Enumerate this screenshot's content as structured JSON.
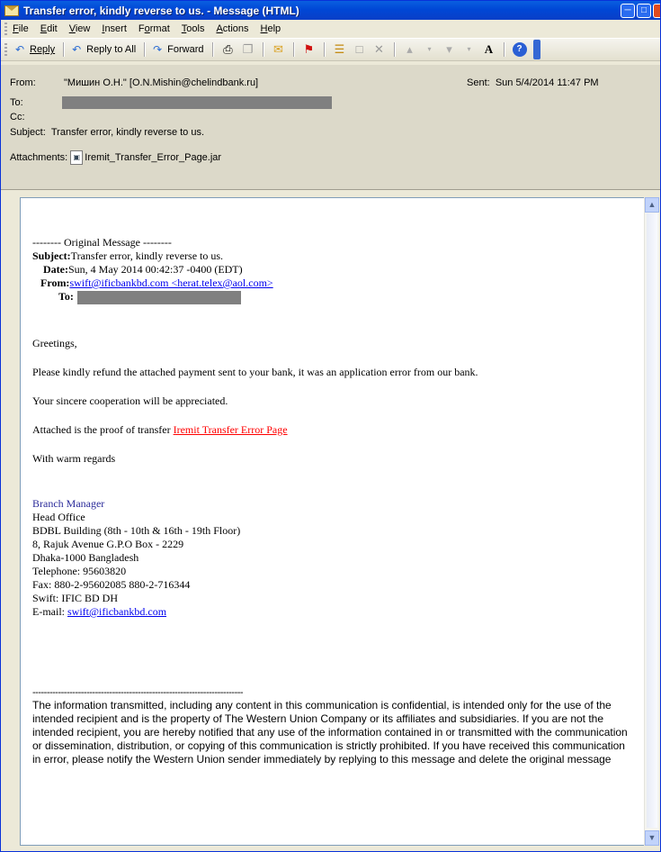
{
  "window": {
    "title": "Transfer error, kindly reverse to us. - Message (HTML)"
  },
  "menu": [
    "File",
    "Edit",
    "View",
    "Insert",
    "Format",
    "Tools",
    "Actions",
    "Help"
  ],
  "menu_underline": [
    "F",
    "E",
    "V",
    "I",
    "o",
    "T",
    "A",
    "H"
  ],
  "toolbar": {
    "reply": "Reply",
    "reply_all": "Reply to All",
    "forward": "Forward"
  },
  "header": {
    "from_label": "From:",
    "from_value": "\"Мишин О.Н.\" [O.N.Mishin@chelindbank.ru]",
    "sent_label": "Sent:",
    "sent_value": "Sun 5/4/2014 11:47 PM",
    "to_label": "To:",
    "cc_label": "Cc:",
    "subject_label": "Subject:",
    "subject_value": "Transfer error, kindly reverse to us.",
    "attachments_label": "Attachments:",
    "attachment_name": "Iremit_Transfer_Error_Page.jar"
  },
  "body": {
    "original_message": "-------- Original Message --------",
    "subject_label": "Subject:",
    "subject_value": "Transfer error, kindly reverse to us.",
    "date_label": "Date:",
    "date_value": "Sun, 4 May 2014 00:42:37 -0400 (EDT)",
    "from_label": "From:",
    "from_value": "swift@ificbankbd.com <herat.telex@aol.com>",
    "to_label": "To:",
    "greeting": "Greetings,",
    "para1": "Please kindly refund the attached payment sent to your bank, it was an application error from our bank.",
    "para2": "Your sincere cooperation will be appreciated.",
    "para3_prefix": "Attached is the proof of transfer ",
    "para3_link": "Iremit Transfer Error Page",
    "regards": "With warm regards",
    "signature": {
      "title": "Branch Manager",
      "lines": [
        "Head Office",
        "BDBL Building (8th - 10th & 16th - 19th Floor)",
        "8, Rajuk Avenue G.P.O Box - 2229",
        "Dhaka-1000 Bangladesh",
        "Telephone: 95603820",
        "Fax: 880-2-95602085 880-2-716344",
        "Swift: IFIC BD DH"
      ],
      "email_label": "E-mail: ",
      "email": "swift@ificbankbd.com"
    },
    "divider": "--------------------------------------------------------------------------",
    "disclaimer": "The information transmitted, including any content in this communication is confidential, is intended only for the use of the intended recipient and is the property of The Western Union Company or its affiliates and subsidiaries. If you are not the intended recipient, you are hereby notified that any use of the information contained in or transmitted with the communication or dissemination, distribution, or copying of this communication is strictly prohibited. If you have received this communication in error, please notify the Western Union sender immediately by replying to this message and delete the original message"
  }
}
